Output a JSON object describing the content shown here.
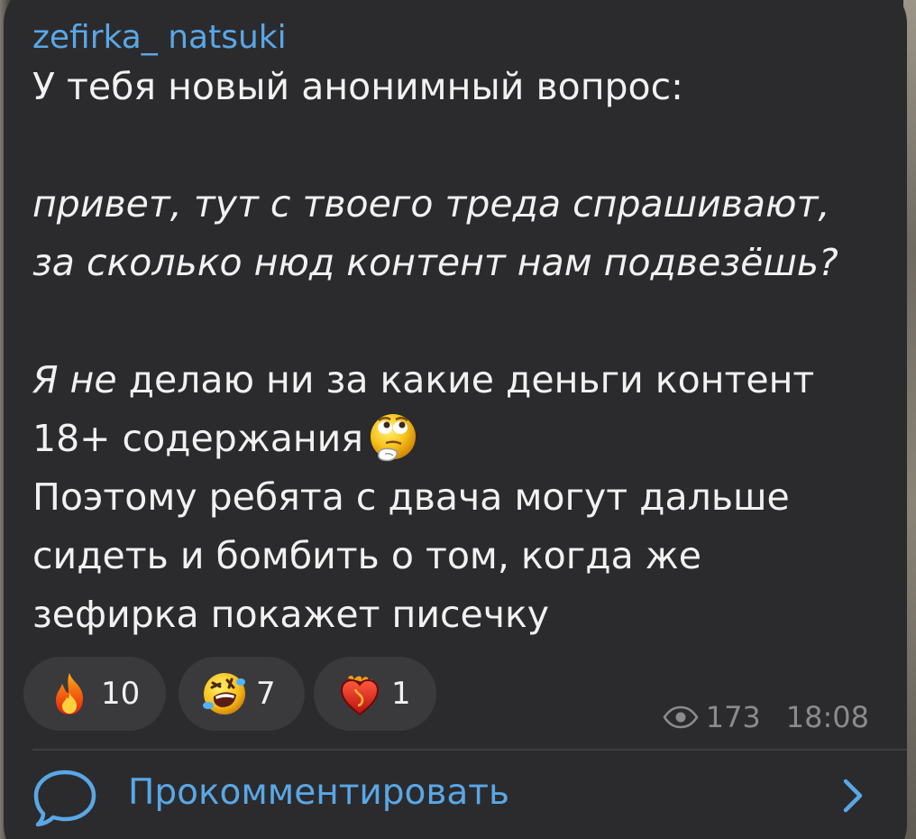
{
  "post": {
    "author": "zefirka_ natsuki",
    "lines": {
      "l1": "У тебя новый анонимный вопрос:",
      "l2": "привет, тут с твоего треда спрашивают,",
      "l3": "за сколько нюд контент нам подвезёшь?",
      "l4_italic": "Я не",
      "l4_rest": " делаю ни за какие деньги контент",
      "l5": "18+ содержания",
      "l6": "Поэтому ребята с двача могут дальше",
      "l7": "сидеть и бомбить о том, когда же",
      "l8": "зефирка покажет писечку"
    },
    "inline_emoji": "thinking-face-icon"
  },
  "reactions": [
    {
      "icon": "fire-icon",
      "count": "10"
    },
    {
      "icon": "rolling-laughing-icon",
      "count": "7"
    },
    {
      "icon": "heart-on-fire-icon",
      "count": "1"
    }
  ],
  "meta": {
    "views": "173",
    "time": "18:08"
  },
  "comment": {
    "label": "Прокомментировать"
  },
  "colors": {
    "bubble": "#2b2b2d",
    "accent": "#5aa7e6",
    "text": "#f1f1f1",
    "meta": "#8a8a8f",
    "pill": "#3a3a3d"
  }
}
